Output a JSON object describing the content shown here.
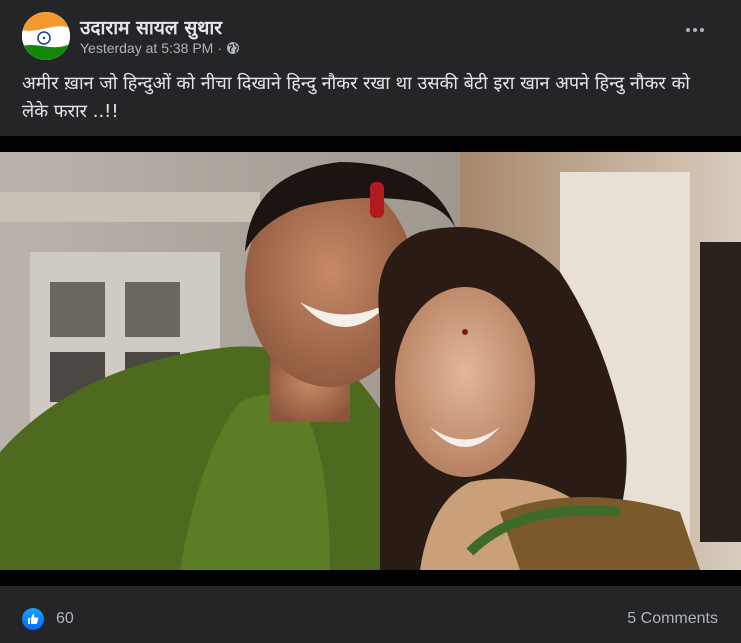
{
  "post": {
    "author": "उदाराम सायल सुथार",
    "timestamp": "Yesterday at 5:38 PM",
    "separator": "·",
    "audience_icon": "globe-icon",
    "text": "अमीर ख़ान जो हिन्दुओं को नीचा दिखाने हिन्दु नौकर रखा था उसकी बेटी इरा खान अपने हिन्दु नौकर को लेके फरार ..!!",
    "image_icon": "photo-couple"
  },
  "reactions": {
    "icon": "like-icon",
    "count": "60",
    "comments": "5 Comments"
  },
  "colors": {
    "card_bg": "#242526",
    "text_primary": "#e4e6eb",
    "text_secondary": "#b0b3b8",
    "like_blue": "#0866ff"
  }
}
